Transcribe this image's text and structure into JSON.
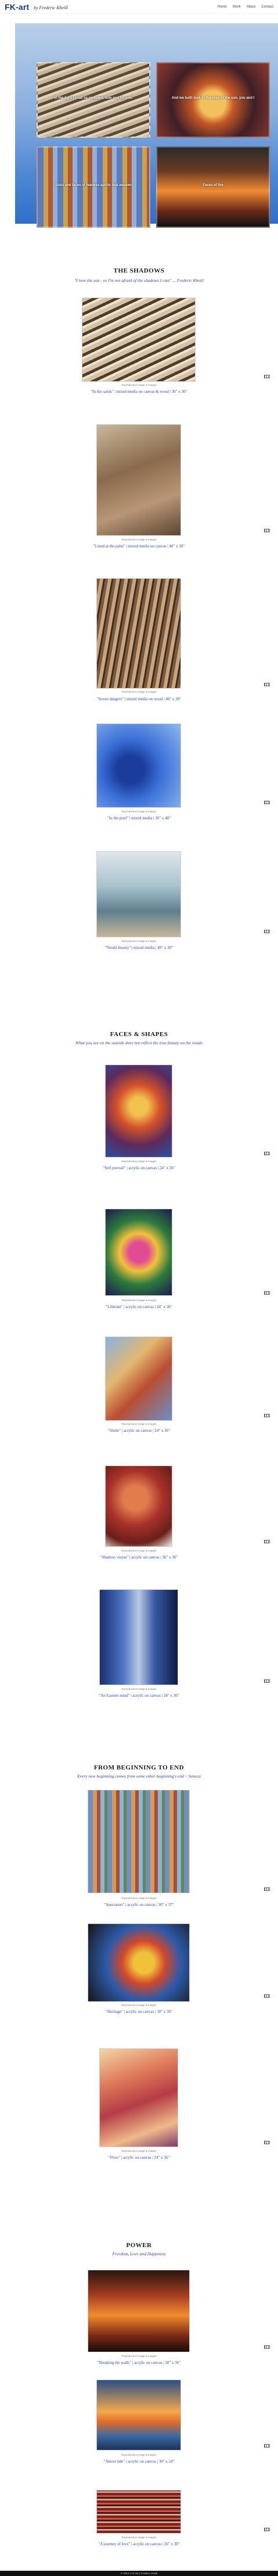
{
  "header": {
    "logo": "FK-art",
    "logo_sub": "by Frederic Kheill",
    "nav": [
      "Home",
      "Work",
      "About",
      "Contact"
    ]
  },
  "hero": {
    "tiles": [
      "In the light I shall be revealed, now and for ever",
      "And we both look in the eyes of the sun, you and I",
      "Stars and faces of fearless spirits that awaken",
      "Faces of fire"
    ],
    "dots": "• • • •"
  },
  "sections": [
    {
      "title": "THE SHADOWS",
      "subtitle": "\"I love the sun - so I'm not afraid of the shadows I cast\" ... Frederic Kheill",
      "items": [
        {
          "credit": "Reproduction image & images",
          "title": "\"In the sands\" | mixed media on canvas & wood | 36\" x 36\""
        },
        {
          "credit": "Reproduction image & images",
          "title": "\"Lined at the palm\" | mixed media on canvas | 40\" x 30\""
        },
        {
          "credit": "Reproduction image & images",
          "title": "\"Seven dangers\" | mixed media on wood | 40\" x 30\""
        },
        {
          "credit": "Reproduction image & images",
          "title": "\"In the pool\" | mixed media | 36\" x 48\""
        },
        {
          "credit": "Reproduction image & images",
          "title": "\"Nestlé beauty\" | mixed media | 40\" x 30\""
        }
      ]
    },
    {
      "title": "FACES & SHAPES",
      "subtitle": "What you see on the outside does not reflect the true beauty on the inside",
      "items": [
        {
          "credit": "Reproduction image & images",
          "title": "\"Self portrait\" | acrylic on canvas | 24\" x 36\""
        },
        {
          "credit": "Reproduction image & images",
          "title": "\"Liberate\" | acrylic on canvas | 24\" x 36\""
        },
        {
          "credit": "Reproduction image & images",
          "title": "\"Smile\" | acrylic on canvas | 24\" x 36\""
        },
        {
          "credit": "Reproduction image & images",
          "title": "\"Shadow, vision\" | acrylic on canvas | 36\" x 36\""
        },
        {
          "credit": "Reproduction image & images",
          "title": "\"An Eastern mind\" | acrylic on canvas | 24\" x 36\""
        }
      ]
    },
    {
      "title": "FROM BEGINNING TO END",
      "subtitle": "Every new beginning comes from some other beginning's end  ~ Seneca",
      "items": [
        {
          "credit": "Reproduction image & images",
          "title": "\"Spectators\" | acrylic on canvas | 30\" x 37\""
        },
        {
          "credit": "Reproduction image & images",
          "title": "\"Heritage\" | acrylic on canvas | 30\" x 36\""
        },
        {
          "credit": "Reproduction image & images",
          "title": "\"Flow\" | acrylic on canvas | 24\" x 36\""
        }
      ]
    },
    {
      "title": "POWER",
      "subtitle": "Freedom, Love and Happiness",
      "items": [
        {
          "credit": "Reproduction image & images",
          "title": "\"Breaking the walls\" | acrylic on canvas | 30\" x 36\""
        },
        {
          "credit": "Reproduction image & images",
          "title": "\"Above tide\" | acrylic on canvas | 30\" x 24\""
        },
        {
          "credit": "Reproduction image & images",
          "title": "\"A journey of love\" | acrylic on canvas | 36\" x 30\""
        }
      ]
    }
  ],
  "footer": "© 2013 | FK-art | Frederic Kheill"
}
